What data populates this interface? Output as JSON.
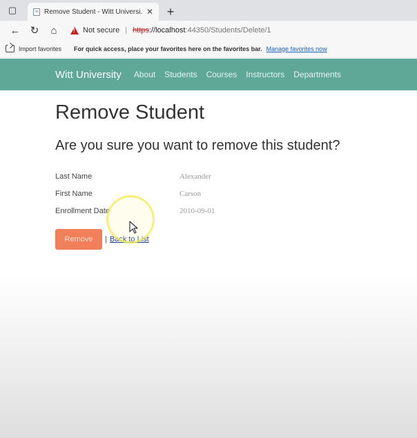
{
  "browser": {
    "tab_title": "Remove Student - Witt Universi...",
    "not_secure_label": "Not secure",
    "url_scheme": "https",
    "url_host": "://localhost",
    "url_rest": ":44350/Students/Delete/1",
    "favorites": {
      "import_label": "Import favorites",
      "message": "For quick access, place your favorites here on the favorites bar.",
      "manage_link": "Manage favorites now"
    }
  },
  "navbar": {
    "brand": "Witt University",
    "links": [
      "About",
      "Students",
      "Courses",
      "Instructors",
      "Departments"
    ]
  },
  "page": {
    "title": "Remove Student",
    "subtitle": "Are you sure you want to remove this student?",
    "fields": [
      {
        "label": "Last Name",
        "value": "Alexander"
      },
      {
        "label": "First Name",
        "value": "Carson"
      },
      {
        "label": "Enrollment Date",
        "value": "2010-09-01"
      }
    ],
    "remove_label": "Remove",
    "separator": "|",
    "back_label": "Back to List"
  },
  "colors": {
    "navbar": "#5fa898",
    "remove_button": "#f07f5a",
    "not_secure": "#c5221f"
  }
}
